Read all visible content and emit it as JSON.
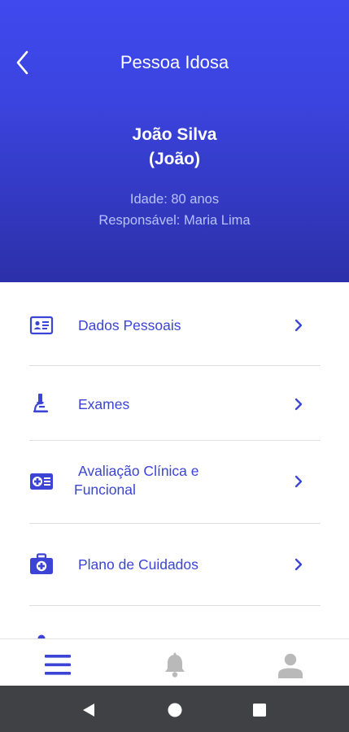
{
  "header": {
    "title": "Pessoa Idosa",
    "name": "João Silva",
    "nickname": "(João)",
    "age": "Idade: 80 anos",
    "responsible": "Responsável: Maria Lima"
  },
  "menu": {
    "items": [
      {
        "label": "Dados Pessoais",
        "icon": "id-card-icon"
      },
      {
        "label": "Exames",
        "icon": "microscope-icon"
      },
      {
        "label_line1": "Avaliação Clínica e",
        "label_line2": "Funcional",
        "icon": "medical-record-icon"
      },
      {
        "label": "Plano de Cuidados",
        "icon": "medical-kit-icon"
      },
      {
        "label": "",
        "icon": "person-icon"
      }
    ]
  },
  "bottom_nav": {
    "items": [
      {
        "icon": "menu-icon",
        "active": true
      },
      {
        "icon": "bell-icon",
        "active": false
      },
      {
        "icon": "profile-icon",
        "active": false
      }
    ]
  },
  "colors": {
    "accent": "#3b44d4",
    "header_top": "#3f49ee",
    "header_bottom": "#2c30a9",
    "subtitle": "#b7c2ff",
    "inactive_icon": "#b9b9b9",
    "system_bar": "#3f4145"
  }
}
